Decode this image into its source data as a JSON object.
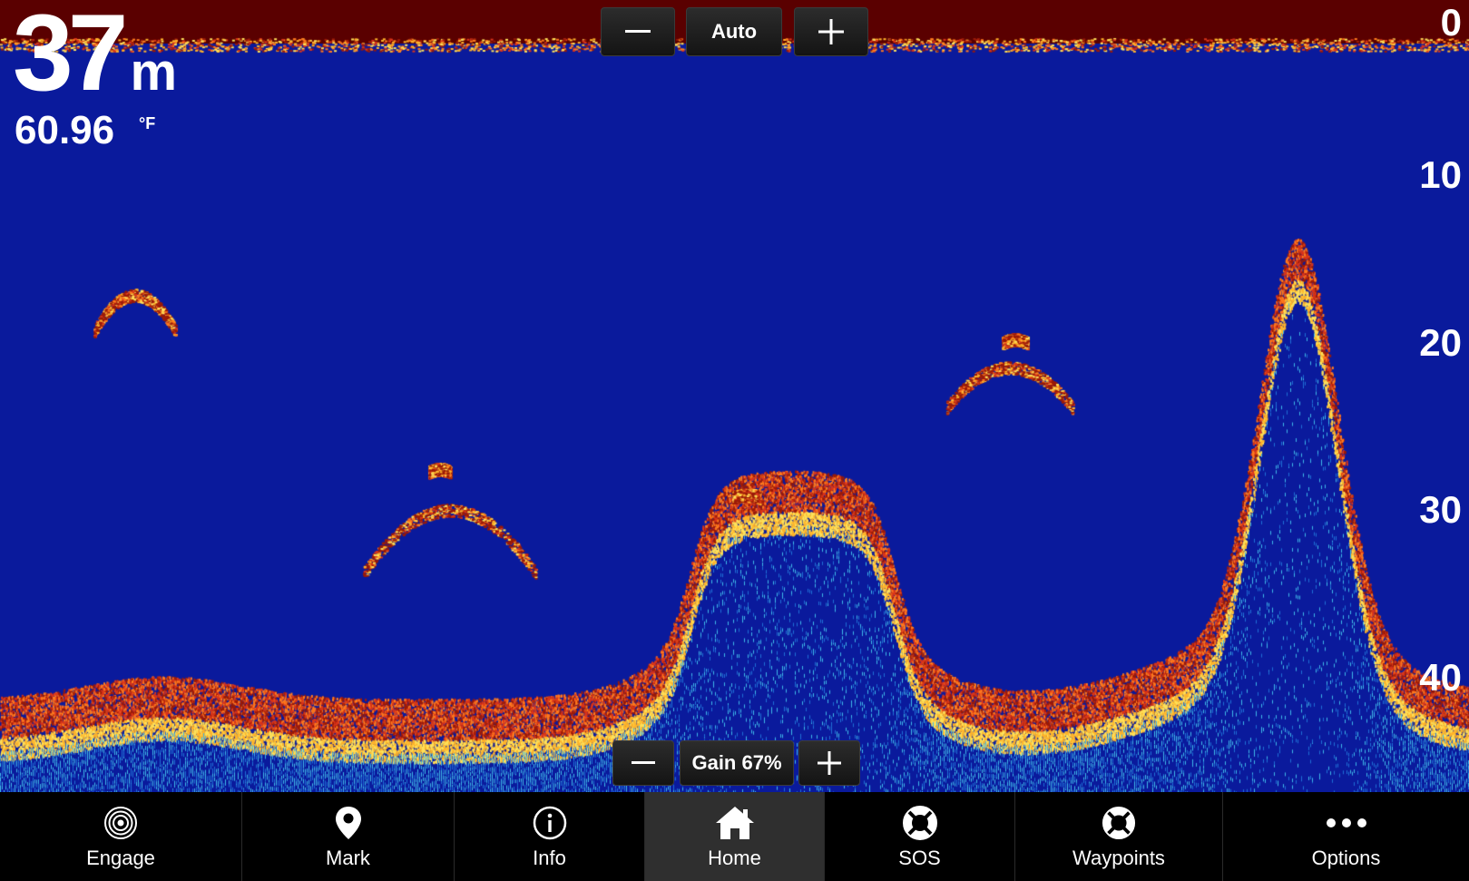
{
  "depth": {
    "value": "37",
    "unit": "m"
  },
  "temperature": {
    "value": "60.96",
    "unit": "°F"
  },
  "range_control": {
    "minus_icon": "minus-icon",
    "label": "Auto",
    "plus_icon": "plus-icon"
  },
  "gain_control": {
    "minus_icon": "minus-icon",
    "label": "Gain 67%",
    "plus_icon": "plus-icon"
  },
  "depth_scale": [
    "0",
    "10",
    "20",
    "30",
    "40"
  ],
  "colors": {
    "water": "#0a1a9c",
    "surface": "#5a0000",
    "strong_return": "#8b1a00",
    "toolbar": "#000000",
    "active_tab": "#2f2f2f"
  },
  "toolbar": {
    "items": [
      {
        "label": "Engage",
        "icon": "sonar-engage-icon"
      },
      {
        "label": "Mark",
        "icon": "map-pin-icon"
      },
      {
        "label": "Info",
        "icon": "info-icon"
      },
      {
        "label": "Home",
        "icon": "home-icon",
        "active": true
      },
      {
        "label": "SOS",
        "icon": "lifebuoy-icon"
      },
      {
        "label": "Waypoints",
        "icon": "waypoint-icon"
      },
      {
        "label": "Options",
        "icon": "more-options-icon"
      }
    ]
  }
}
